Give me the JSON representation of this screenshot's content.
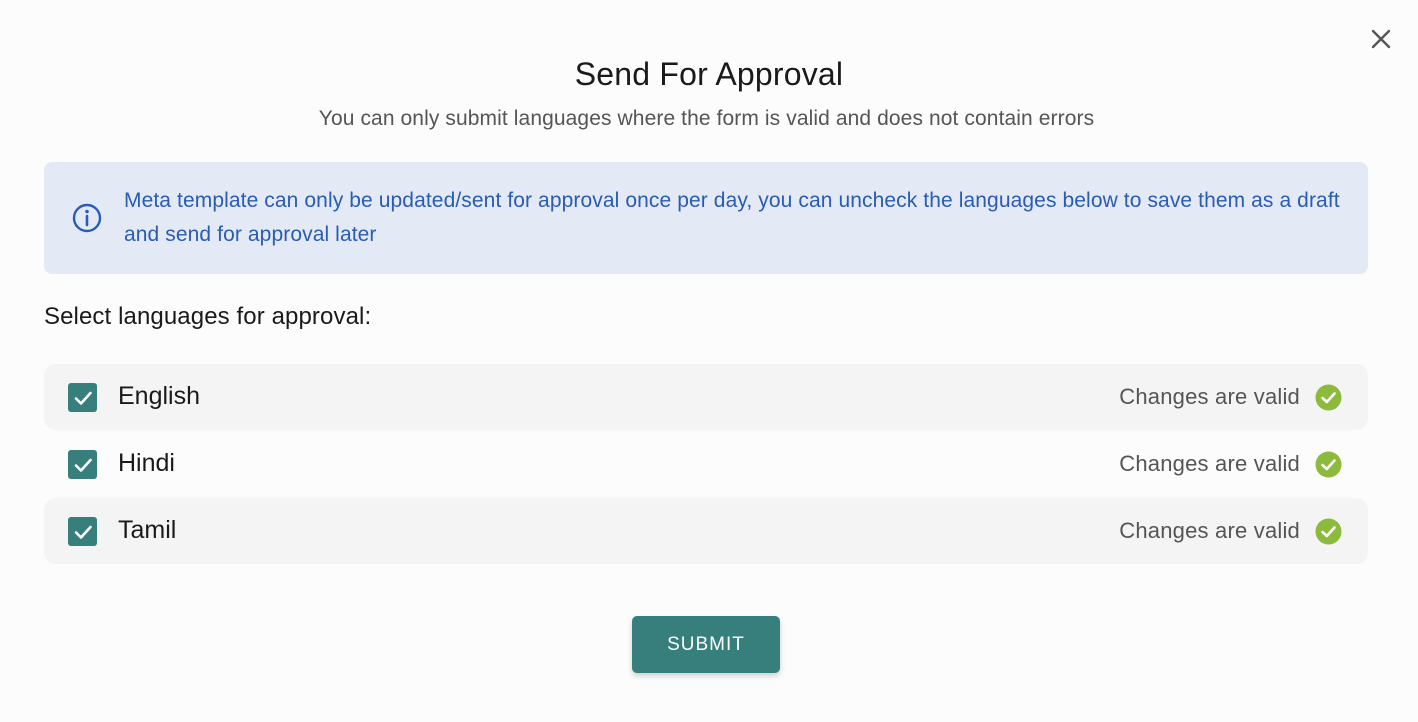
{
  "dialog": {
    "title": "Send For Approval",
    "subtitle": "You can only submit languages where the form is valid and does not contain errors",
    "close_icon": "close-icon"
  },
  "info": {
    "icon": "info-icon",
    "text": "Meta template can only be updated/sent for approval once per day, you can uncheck the languages below to save them as a draft and send for approval later"
  },
  "languages_section": {
    "label": "Select languages for approval:",
    "items": [
      {
        "name": "English",
        "checked": true,
        "status": "Changes are valid",
        "status_icon": "check-circle-icon"
      },
      {
        "name": "Hindi",
        "checked": true,
        "status": "Changes are valid",
        "status_icon": "check-circle-icon"
      },
      {
        "name": "Tamil",
        "checked": true,
        "status": "Changes are valid",
        "status_icon": "check-circle-icon"
      }
    ]
  },
  "actions": {
    "submit_label": "SUBMIT"
  },
  "colors": {
    "accent": "#377f7c",
    "info_bg": "#e3eaf6",
    "info_text": "#2a5bb5",
    "valid": "#8cba3c"
  }
}
